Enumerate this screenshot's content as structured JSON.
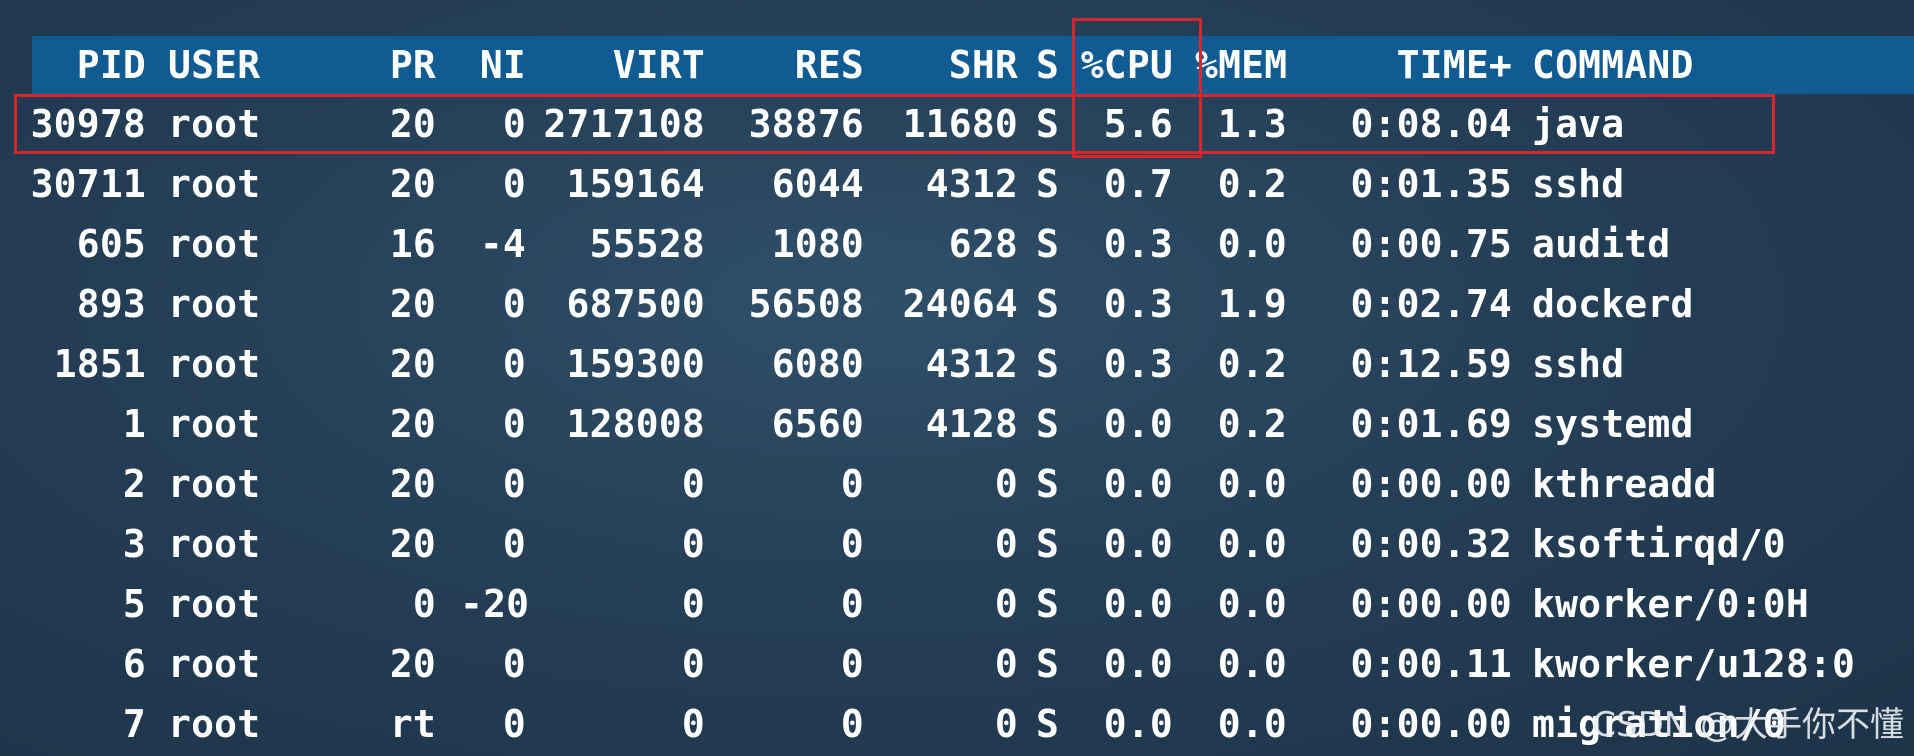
{
  "header": {
    "pid": "PID",
    "user": "USER",
    "pr": "PR",
    "ni": "NI",
    "virt": "VIRT",
    "res": "RES",
    "shr": "SHR",
    "s": "S",
    "cpu": "%CPU",
    "mem": "%MEM",
    "time": "TIME+",
    "command": "COMMAND"
  },
  "processes": [
    {
      "pid": "30978",
      "user": "root",
      "pr": "20",
      "ni": "0",
      "virt": "2717108",
      "res": "38876",
      "shr": "11680",
      "s": "S",
      "cpu": "5.6",
      "mem": "1.3",
      "time": "0:08.04",
      "command": "java"
    },
    {
      "pid": "30711",
      "user": "root",
      "pr": "20",
      "ni": "0",
      "virt": "159164",
      "res": "6044",
      "shr": "4312",
      "s": "S",
      "cpu": "0.7",
      "mem": "0.2",
      "time": "0:01.35",
      "command": "sshd"
    },
    {
      "pid": "605",
      "user": "root",
      "pr": "16",
      "ni": "-4",
      "virt": "55528",
      "res": "1080",
      "shr": "628",
      "s": "S",
      "cpu": "0.3",
      "mem": "0.0",
      "time": "0:00.75",
      "command": "auditd"
    },
    {
      "pid": "893",
      "user": "root",
      "pr": "20",
      "ni": "0",
      "virt": "687500",
      "res": "56508",
      "shr": "24064",
      "s": "S",
      "cpu": "0.3",
      "mem": "1.9",
      "time": "0:02.74",
      "command": "dockerd"
    },
    {
      "pid": "1851",
      "user": "root",
      "pr": "20",
      "ni": "0",
      "virt": "159300",
      "res": "6080",
      "shr": "4312",
      "s": "S",
      "cpu": "0.3",
      "mem": "0.2",
      "time": "0:12.59",
      "command": "sshd"
    },
    {
      "pid": "1",
      "user": "root",
      "pr": "20",
      "ni": "0",
      "virt": "128008",
      "res": "6560",
      "shr": "4128",
      "s": "S",
      "cpu": "0.0",
      "mem": "0.2",
      "time": "0:01.69",
      "command": "systemd"
    },
    {
      "pid": "2",
      "user": "root",
      "pr": "20",
      "ni": "0",
      "virt": "0",
      "res": "0",
      "shr": "0",
      "s": "S",
      "cpu": "0.0",
      "mem": "0.0",
      "time": "0:00.00",
      "command": "kthreadd"
    },
    {
      "pid": "3",
      "user": "root",
      "pr": "20",
      "ni": "0",
      "virt": "0",
      "res": "0",
      "shr": "0",
      "s": "S",
      "cpu": "0.0",
      "mem": "0.0",
      "time": "0:00.32",
      "command": "ksoftirqd/0"
    },
    {
      "pid": "5",
      "user": "root",
      "pr": "0",
      "ni": "-20",
      "virt": "0",
      "res": "0",
      "shr": "0",
      "s": "S",
      "cpu": "0.0",
      "mem": "0.0",
      "time": "0:00.00",
      "command": "kworker/0:0H"
    },
    {
      "pid": "6",
      "user": "root",
      "pr": "20",
      "ni": "0",
      "virt": "0",
      "res": "0",
      "shr": "0",
      "s": "S",
      "cpu": "0.0",
      "mem": "0.0",
      "time": "0:00.11",
      "command": "kworker/u128:0"
    },
    {
      "pid": "7",
      "user": "root",
      "pr": "rt",
      "ni": "0",
      "virt": "0",
      "res": "0",
      "shr": "0",
      "s": "S",
      "cpu": "0.0",
      "mem": "0.0",
      "time": "0:00.00",
      "command": "migration/0"
    }
  ],
  "watermark": "CSDN @大手你不懂",
  "colors": {
    "header_bar": "#0f5b92",
    "highlight_box": "#d8262f",
    "text": "#ffffff"
  }
}
